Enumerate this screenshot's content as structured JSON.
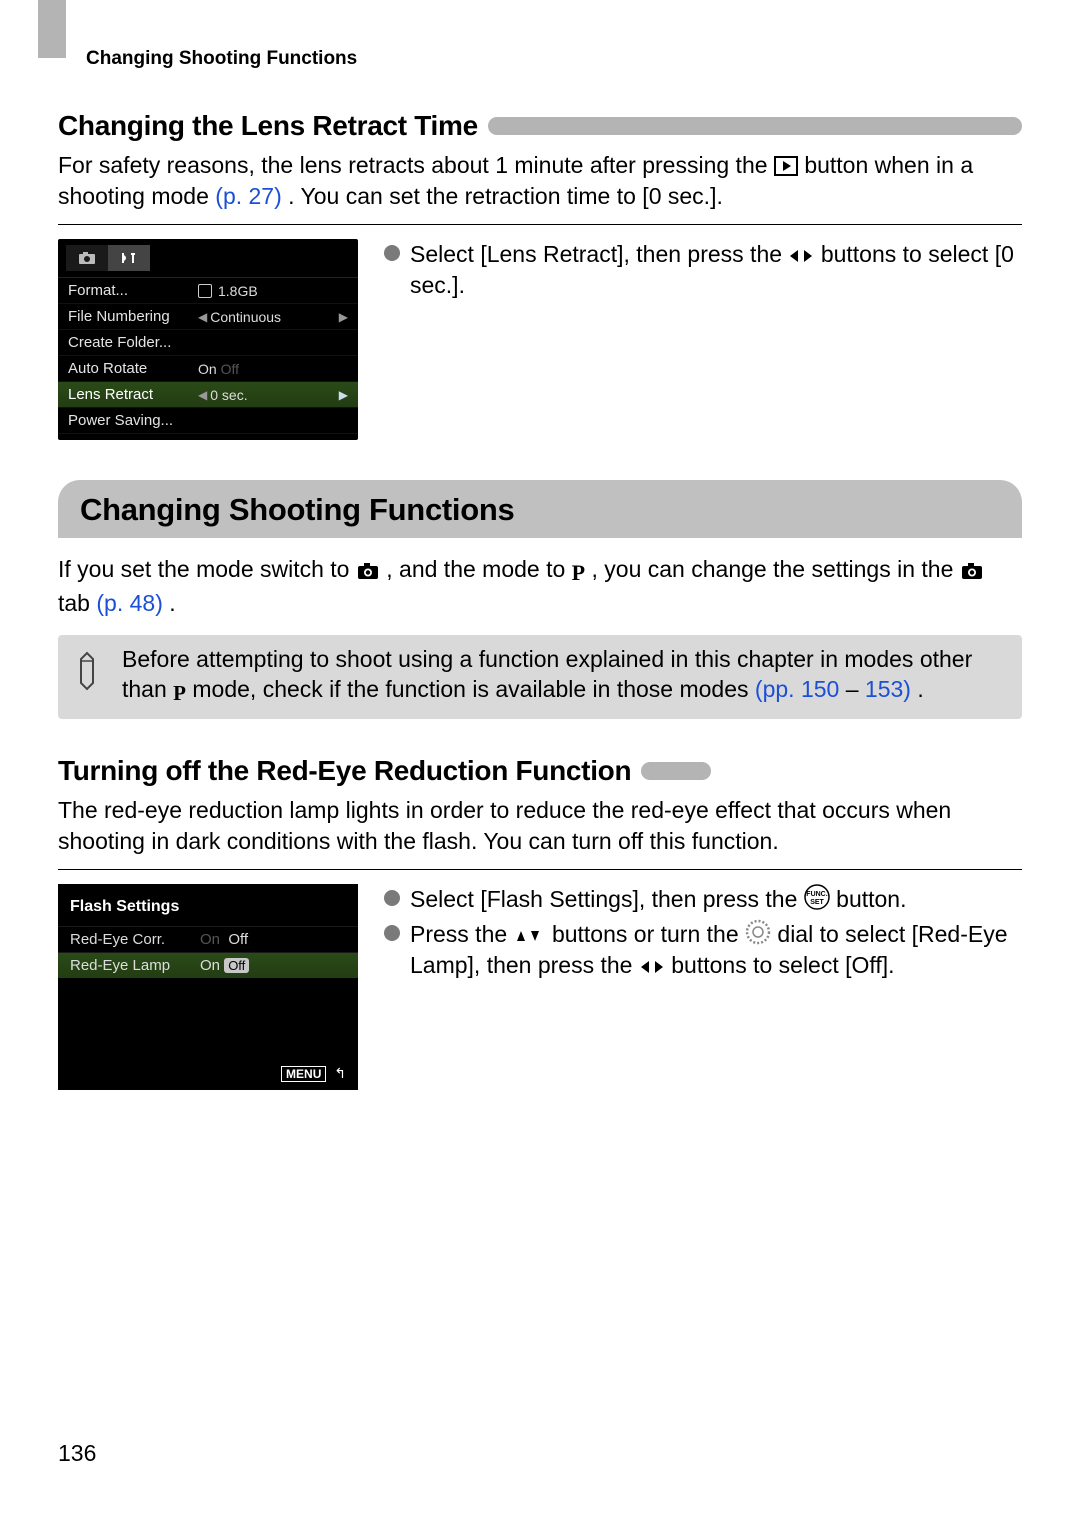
{
  "header": {
    "breadcrumb": "Changing Shooting Functions"
  },
  "section1": {
    "title": "Changing the Lens Retract Time",
    "intro_a": "For safety reasons, the lens retracts about 1 minute after pressing the ",
    "intro_b": " button when in a shooting mode ",
    "intro_link": "(p. 27)",
    "intro_c": ". You can set the retraction time to [0 sec.].",
    "bullet_a": "Select [Lens Retract], then press the ",
    "bullet_b": " buttons to select [0 sec.]."
  },
  "menu1": {
    "rows": [
      {
        "label": "Format...",
        "value_icon": true,
        "value": "1.8GB"
      },
      {
        "label": "File Numbering",
        "value": "Continuous",
        "arrows": true
      },
      {
        "label": "Create Folder...",
        "value": ""
      },
      {
        "label": "Auto Rotate",
        "value_on": "On",
        "value_off": "Off"
      },
      {
        "label": "Lens Retract",
        "value": "0 sec.",
        "selected": true,
        "arrows": true
      },
      {
        "label": "Power Saving...",
        "value": ""
      }
    ]
  },
  "banner": {
    "title": "Changing Shooting Functions"
  },
  "banner_text": {
    "a": "If you set the mode switch to ",
    "b": ", and the mode to ",
    "c": ", you can change the settings in the ",
    "d": " tab ",
    "link": "(p. 48)",
    "e": "."
  },
  "note": {
    "a": "Before attempting to shoot using a function explained in this chapter in modes other than ",
    "b": " mode, check if the function is available in those modes ",
    "link1": "(pp. 150",
    "dash": " – ",
    "link2": "153)",
    "c": "."
  },
  "section2": {
    "title": "Turning off the Red-Eye Reduction Function",
    "intro": "The red-eye reduction lamp lights in order to reduce the red-eye effect that occurs when shooting in dark conditions with the flash. You can turn off this function.",
    "bullet1_a": "Select [Flash Settings], then press the ",
    "bullet1_b": " button.",
    "bullet2_a": "Press the ",
    "bullet2_b": " buttons or turn the ",
    "bullet2_c": " dial to select [Red-Eye Lamp], then press the ",
    "bullet2_d": " buttons to select [Off]."
  },
  "menu2": {
    "title": "Flash Settings",
    "rows": [
      {
        "label": "Red-Eye Corr.",
        "on": "On",
        "off": "Off",
        "off_active": true
      },
      {
        "label": "Red-Eye Lamp",
        "on": "On",
        "off": "Off",
        "off_active": true,
        "selected": true
      }
    ],
    "footer": "MENU"
  },
  "page": "136"
}
